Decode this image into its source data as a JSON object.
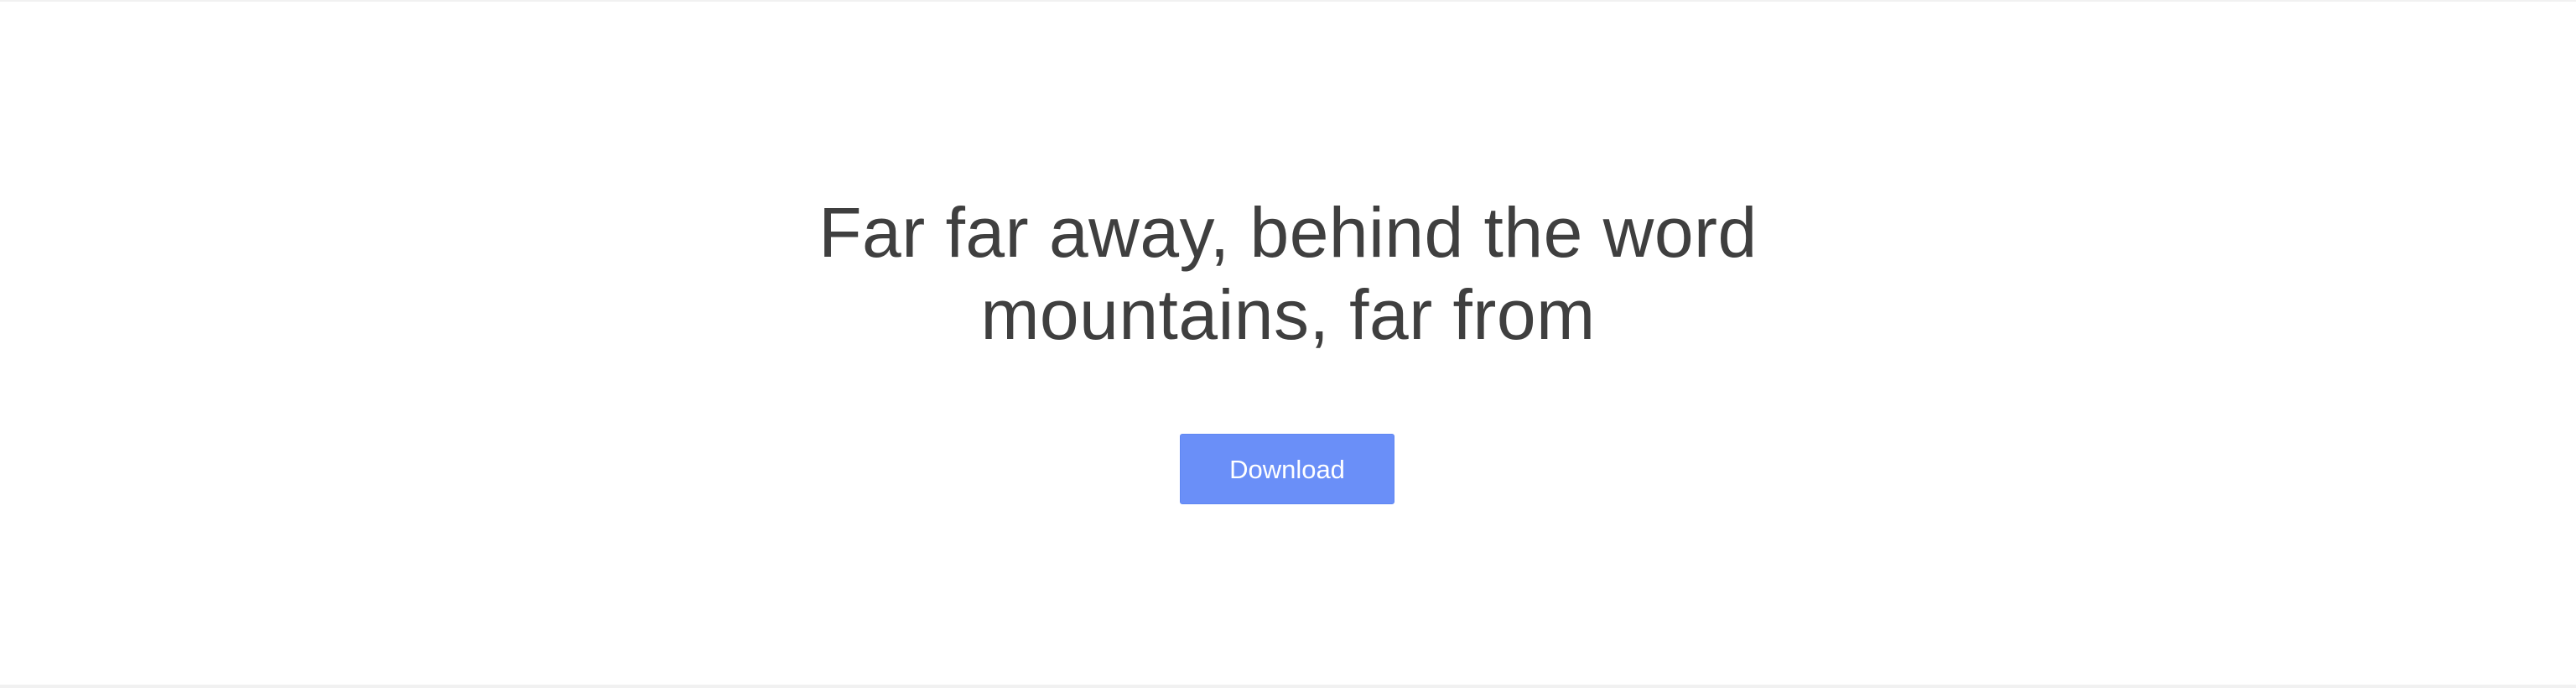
{
  "hero": {
    "headline_line_1": "Far far away, behind the word",
    "headline_line_2": "mountains, far from",
    "download_label": "Download"
  },
  "colors": {
    "page_background": "#ffffff",
    "outer_background": "#f1f1f1",
    "headline_text": "#3f3f3f",
    "button_background": "#6a8ff8",
    "button_text": "#ffffff"
  }
}
